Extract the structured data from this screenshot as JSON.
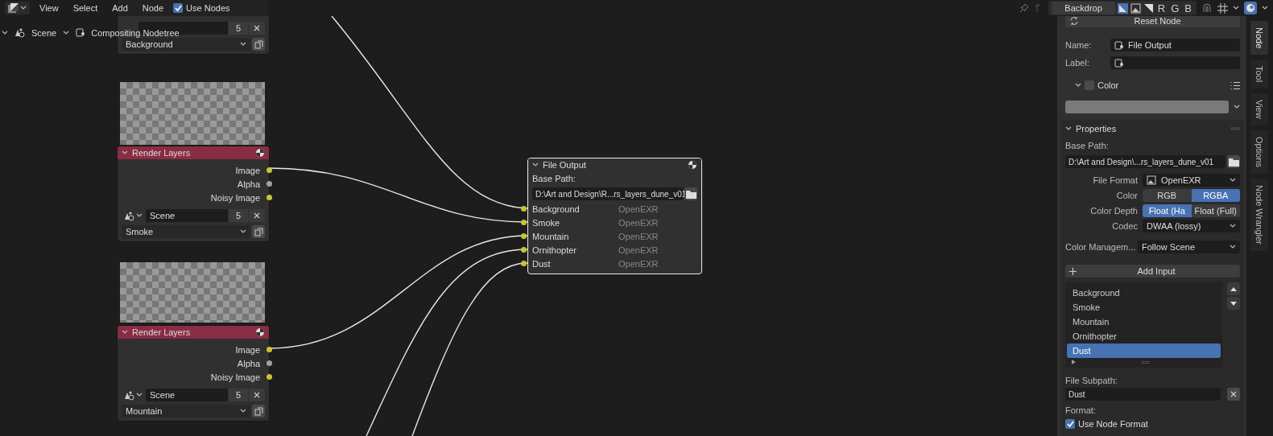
{
  "header": {
    "menus": [
      "View",
      "Select",
      "Add",
      "Node"
    ],
    "use_nodes": {
      "label": "Use Nodes",
      "checked": true
    },
    "backdrop": "Backdrop",
    "channels": [
      "R",
      "G",
      "B"
    ]
  },
  "breadcrumb": [
    "Scene",
    "Compositing Nodetree"
  ],
  "nodes": [
    {
      "kind": "cut",
      "users": "5",
      "layer": "Background"
    },
    {
      "kind": "render_layers",
      "title": "Render Layers",
      "outputs": [
        {
          "label": "Image",
          "color": "#c7c729"
        },
        {
          "label": "Alpha",
          "color": "#a1a1a1"
        },
        {
          "label": "Noisy Image",
          "color": "#c7c729"
        }
      ],
      "scene": "Scene",
      "users": "5",
      "layer": "Smoke"
    },
    {
      "kind": "render_layers",
      "title": "Render Layers",
      "outputs": [
        {
          "label": "Image",
          "color": "#c7c729"
        },
        {
          "label": "Alpha",
          "color": "#a1a1a1"
        },
        {
          "label": "Noisy Image",
          "color": "#c7c729"
        }
      ],
      "scene": "Scene",
      "users": "5",
      "layer": "Mountain"
    }
  ],
  "file_output": {
    "title": "File Output",
    "base_path_label": "Base Path:",
    "base_path": "D:\\Art and Design\\R...rs_layers_dune_v01",
    "inputs": [
      {
        "label": "Background",
        "format": "OpenEXR"
      },
      {
        "label": "Smoke",
        "format": "OpenEXR"
      },
      {
        "label": "Mountain",
        "format": "OpenEXR"
      },
      {
        "label": "Ornithopter",
        "format": "OpenEXR"
      },
      {
        "label": "Dust",
        "format": "OpenEXR"
      }
    ]
  },
  "sidebar": {
    "reset": "Reset Node",
    "name_label": "Name:",
    "name": "File Output",
    "label_label": "Label:",
    "color": {
      "label": "Color",
      "checked": false
    },
    "properties": "Properties",
    "base_path_label": "Base Path:",
    "base_path": "D:\\Art and Design\\...rs_layers_dune_v01",
    "rows": [
      {
        "kind": "dropdown",
        "label": "File Format",
        "value": "OpenEXR"
      },
      {
        "kind": "toggle",
        "label": "Color",
        "options": [
          {
            "label": "RGB",
            "selected": false
          },
          {
            "label": "RGBA",
            "selected": true
          }
        ]
      },
      {
        "kind": "toggle",
        "label": "Color Depth",
        "options": [
          {
            "label": "Float (Ha",
            "selected": true
          },
          {
            "label": "Float (Full)",
            "selected": false
          }
        ]
      },
      {
        "kind": "dropdown",
        "label": "Codec",
        "value": "DWAA (lossy)"
      }
    ],
    "color_management_label": "Color Managem...",
    "color_management": "Follow Scene",
    "add_input": "Add Input",
    "inputs": [
      {
        "label": "Background",
        "selected": false
      },
      {
        "label": "Smoke",
        "selected": false
      },
      {
        "label": "Mountain",
        "selected": false
      },
      {
        "label": "Ornithopter",
        "selected": false
      },
      {
        "label": "Dust",
        "selected": true
      }
    ],
    "subpath_label": "File Subpath:",
    "subpath": "Dust",
    "format_label": "Format:",
    "use_node_format": {
      "label": "Use Node Format",
      "checked": true
    }
  },
  "tabs": [
    {
      "label": "Node",
      "selected": true
    },
    {
      "label": "Tool",
      "selected": false
    },
    {
      "label": "View",
      "selected": false
    },
    {
      "label": "Options",
      "selected": false
    },
    {
      "label": "Node Wrangler",
      "selected": false
    }
  ]
}
